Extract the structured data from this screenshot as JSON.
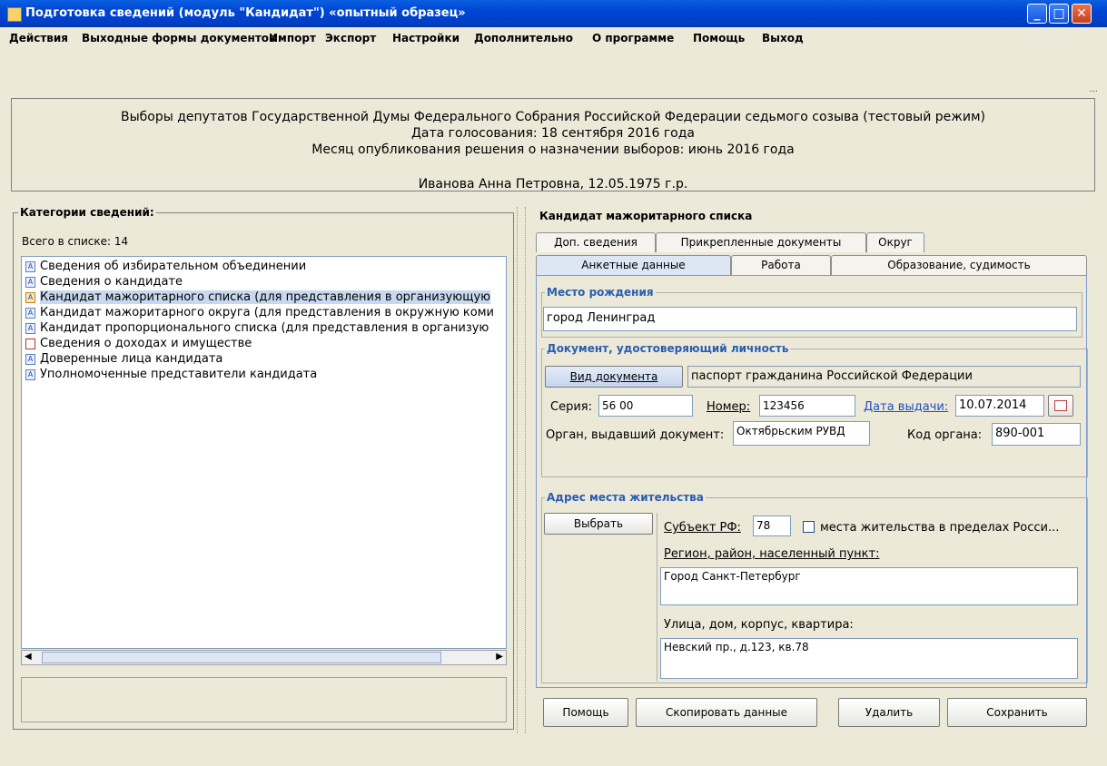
{
  "window": {
    "title": "Подготовка сведений (модуль \"Кандидат\") «опытный образец»"
  },
  "menu": [
    "Действия",
    "Выходные формы документов",
    "Импорт",
    "Экспорт",
    "Настройки",
    "Дополнительно",
    "О программе",
    "Помощь",
    "Выход"
  ],
  "header": {
    "line1": "Выборы депутатов Государственной Думы Федерального Собрания Российской Федерации седьмого созыва (тестовый режим)",
    "line2": "Дата голосования: 18 сентября 2016 года",
    "line3": "Месяц опубликования решения о назначении выборов: июнь 2016 года",
    "line4": "Иванова Анна Петровна, 12.05.1975 г.р."
  },
  "left": {
    "title": "Категории сведений:",
    "count": "Всего в списке: 14",
    "items": [
      "Сведения об избирательном объединении",
      "Сведения о кандидате",
      "Кандидат мажоритарного списка (для представления в организующую",
      "Кандидат мажоритарного округа (для представления в окружную коми",
      "Кандидат пропорционального списка (для представления в организую",
      "Сведения о доходах и имуществе",
      "Доверенные лица кандидата",
      "Уполномоченные представители кандидата"
    ]
  },
  "right": {
    "title": "Кандидат мажоритарного списка",
    "tabs_row1": [
      "Доп. сведения",
      "Прикрепленные документы",
      "Округ"
    ],
    "tabs_row2": [
      "Анкетные данные",
      "Работа",
      "Образование, судимость"
    ],
    "birth": {
      "title": "Место рождения",
      "value": "город Ленинград"
    },
    "doc": {
      "title": "Документ, удостоверяющий личность",
      "type_button": "Вид документа",
      "type_value": "паспорт гражданина Российской Федерации",
      "series_label": "Серия:",
      "series_value": "56 00",
      "number_label": "Номер:",
      "number_value": "123456",
      "date_label": "Дата выдачи:",
      "date_value": "10.07.2014",
      "issuer_label": "Орган, выдавший документ:",
      "issuer_value": "Октябрьским РУВД",
      "code_label": "Код органа:",
      "code_value": "890-001"
    },
    "address": {
      "title": "Адрес места жительства",
      "choose_button": "Выбрать",
      "subject_label": "Субъект РФ:",
      "subject_value": "78",
      "checkbox_label": "места жительства в пределах Росси...",
      "region_label": "Регион, район, населенный пункт:",
      "region_value": "Город Санкт-Петербург",
      "street_label": "Улица, дом, корпус, квартира:",
      "street_value": "Невский пр., д.123, кв.78"
    },
    "buttons": {
      "help": "Помощь",
      "copy": "Скопировать данные",
      "delete": "Удалить",
      "save": "Сохранить"
    }
  }
}
